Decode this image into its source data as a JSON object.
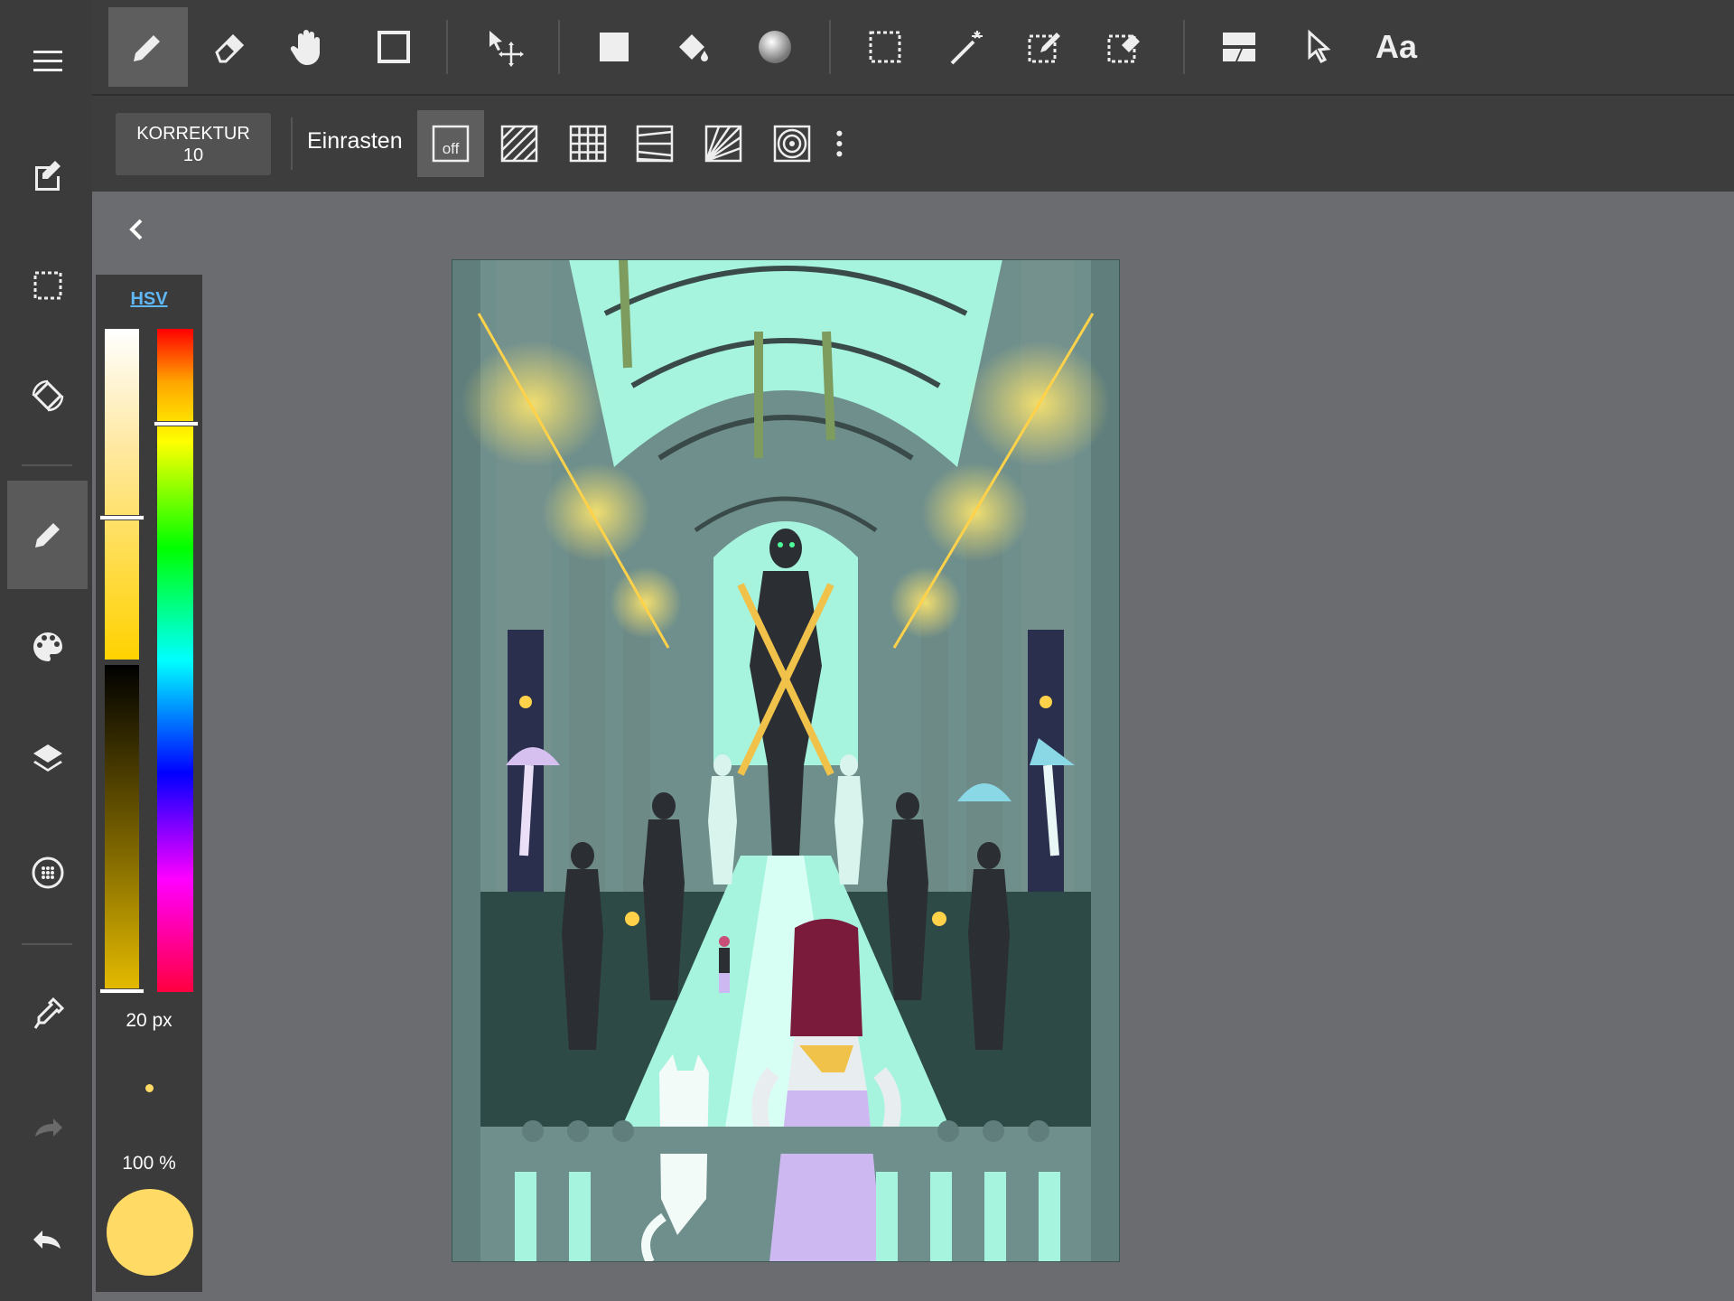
{
  "colors": {
    "current": "#ffdb66",
    "accent_link": "#5fb7f5",
    "toolbar_bg": "#3d3d3d",
    "canvas_bg": "#6a6c70"
  },
  "left_toolbar": {
    "items": [
      {
        "icon": "menu-icon",
        "active": false
      },
      {
        "icon": "edit-canvas-icon",
        "active": false
      },
      {
        "icon": "selection-icon",
        "active": false
      },
      {
        "icon": "rotate-icon",
        "active": false
      },
      {
        "icon": "brush-icon",
        "active": true
      },
      {
        "icon": "palette-icon",
        "active": false
      },
      {
        "icon": "layers-icon",
        "active": false
      },
      {
        "icon": "material-icon",
        "active": false
      },
      {
        "icon": "eyedropper-icon",
        "active": false
      },
      {
        "icon": "redo-icon",
        "active": false
      },
      {
        "icon": "undo-icon",
        "active": false
      }
    ]
  },
  "top_toolbar": {
    "tools": [
      {
        "icon": "pen-icon",
        "active": true
      },
      {
        "icon": "eraser-icon",
        "active": false
      },
      {
        "icon": "hand-icon",
        "active": false
      },
      {
        "icon": "shape-icon",
        "active": false
      },
      {
        "icon": "move-icon",
        "active": false
      },
      {
        "icon": "fill-rect-icon",
        "active": false
      },
      {
        "icon": "bucket-icon",
        "active": false
      },
      {
        "icon": "gradient-icon",
        "active": false
      },
      {
        "icon": "select-rect-icon",
        "active": false
      },
      {
        "icon": "magic-wand-icon",
        "active": false
      },
      {
        "icon": "select-pen-icon",
        "active": false
      },
      {
        "icon": "select-eraser-icon",
        "active": false
      },
      {
        "icon": "frame-divider-icon",
        "active": false
      },
      {
        "icon": "pointer-icon",
        "active": false
      }
    ],
    "text_tool_label": "Aa"
  },
  "options_bar": {
    "correction_label": "KORREKTUR",
    "correction_value": "10",
    "snap_label": "Einrasten",
    "snap_off_label": "off",
    "snap_modes": [
      "snap-off-icon",
      "snap-parallel-icon",
      "snap-grid-icon",
      "snap-perspective-icon",
      "snap-radial-icon",
      "snap-circle-icon",
      "more-icon"
    ]
  },
  "color_panel": {
    "mode_label": "HSV",
    "brush_size": "20 px",
    "opacity": "100 %",
    "brightness_marker": 0.55,
    "hue_marker": 0.12
  }
}
